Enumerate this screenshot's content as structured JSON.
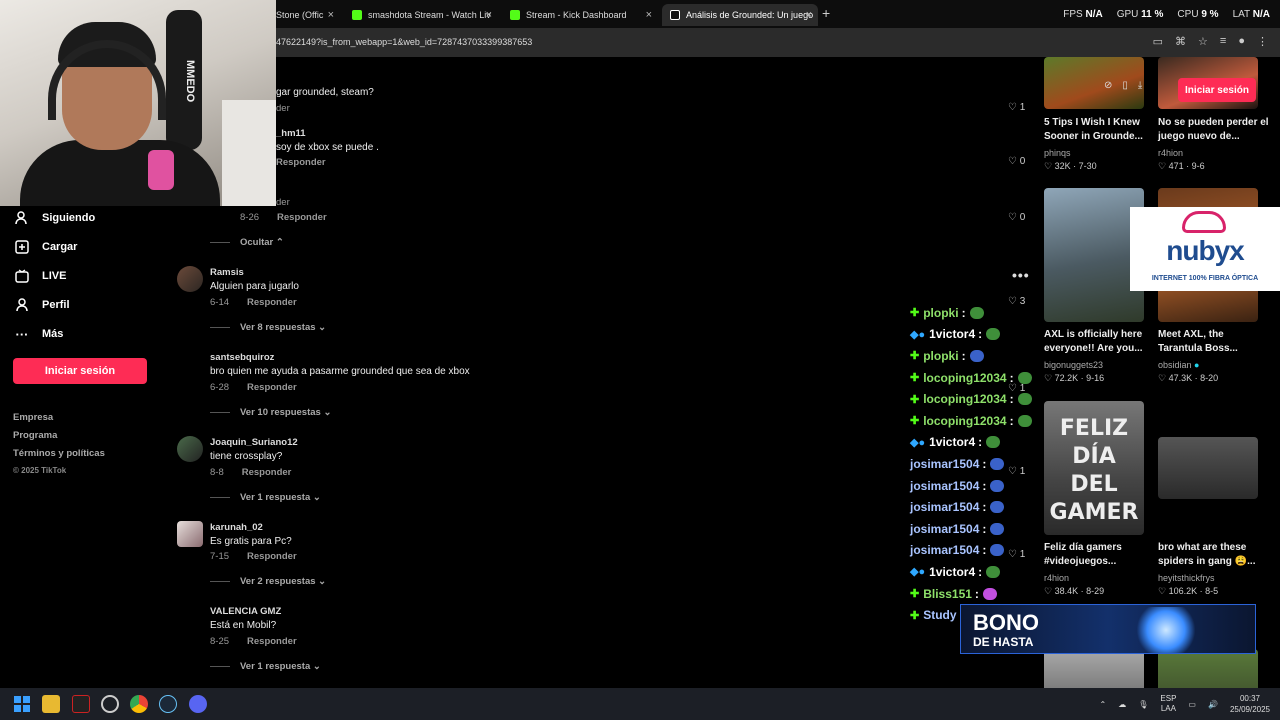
{
  "browser": {
    "tabs": [
      {
        "label": "Stone (Offic",
        "close": "×"
      },
      {
        "label": "smashdota Stream - Watch Liv",
        "close": "×"
      },
      {
        "label": "Stream - Kick Dashboard",
        "close": "×"
      },
      {
        "label": "Análisis de Grounded: Un juego",
        "close": "×"
      }
    ],
    "new_tab": "+",
    "url": "47622149?is_from_webapp=1&web_id=7287437033399387653",
    "stats": {
      "fps_label": "FPS",
      "fps_value": "N/A",
      "gpu_label": "GPU",
      "gpu_value": "11 %",
      "cpu_label": "CPU",
      "cpu_value": "9 %",
      "lat_label": "LAT",
      "lat_value": "N/A"
    }
  },
  "webcam": {
    "bag_text": "MMEDO"
  },
  "nav": {
    "items": [
      {
        "label": "Siguiendo",
        "icon": "following-icon"
      },
      {
        "label": "Cargar",
        "icon": "upload-icon"
      },
      {
        "label": "LIVE",
        "icon": "live-icon"
      },
      {
        "label": "Perfil",
        "icon": "profile-icon"
      },
      {
        "label": "Más",
        "icon": "more-icon"
      }
    ],
    "login": "Iniciar sesión",
    "links": [
      "Empresa",
      "Programa",
      "Términos y políticas"
    ],
    "copyright": "© 2025 TikTok"
  },
  "comments": {
    "partial": [
      {
        "text": "gar grounded, steam?",
        "meta": "der",
        "likes": "1"
      },
      {
        "user": "_hm11",
        "text": "soy de xbox se puede .",
        "reply": "Responder",
        "likes": "0"
      },
      {
        "text": "der",
        "date": "8-26",
        "reply": "Responder",
        "likes": "0"
      }
    ],
    "hide": "Ocultar",
    "list": [
      {
        "user": "Ramsis",
        "text": "Alguien para jugarlo",
        "date": "6-14",
        "reply": "Responder",
        "more": "Ver 8 respuestas",
        "likes": "3"
      },
      {
        "user": "santsebquiroz",
        "text": "bro quien me ayuda a pasarme grounded que sea de xbox",
        "date": "6-28",
        "reply": "Responder",
        "more": "Ver 10 respuestas",
        "likes": "1"
      },
      {
        "user": "Joaquin_Suriano12",
        "text": "tiene crossplay?",
        "date": "8-8",
        "reply": "Responder",
        "more": "Ver 1 respuesta",
        "likes": "1"
      },
      {
        "user": "karunah_02",
        "text": "Es gratis para Pc?",
        "date": "7-15",
        "reply": "Responder",
        "more": "Ver 2 respuestas",
        "likes": "1"
      },
      {
        "user": "VALENCIA GMZ",
        "text": "Está en Mobil?",
        "date": "8-25",
        "reply": "Responder",
        "more": "Ver 1 respuesta"
      }
    ],
    "options": "•••"
  },
  "chat": [
    {
      "user": "plopki",
      "color": "#8ee06a",
      "badge": "kick",
      "emote": "green"
    },
    {
      "user": "1victor4",
      "color": "#ffffff",
      "badge": "multi",
      "emote": "green"
    },
    {
      "user": "plopki",
      "color": "#8ee06a",
      "badge": "kick",
      "emote": "blue"
    },
    {
      "user": "locoping12034",
      "color": "#8ee06a",
      "badge": "kick",
      "emote": "green"
    },
    {
      "user": "locoping12034",
      "color": "#8ee06a",
      "badge": "kick",
      "emote": "green"
    },
    {
      "user": "locoping12034",
      "color": "#8ee06a",
      "badge": "kick",
      "emote": "green"
    },
    {
      "user": "1victor4",
      "color": "#ffffff",
      "badge": "multi",
      "emote": "green"
    },
    {
      "user": "josimar1504",
      "color": "#a9c4ff",
      "badge": "",
      "emote": "blue"
    },
    {
      "user": "josimar1504",
      "color": "#a9c4ff",
      "badge": "",
      "emote": "blue"
    },
    {
      "user": "josimar1504",
      "color": "#a9c4ff",
      "badge": "",
      "emote": "blue"
    },
    {
      "user": "josimar1504",
      "color": "#a9c4ff",
      "badge": "",
      "emote": "blue"
    },
    {
      "user": "josimar1504",
      "color": "#a9c4ff",
      "badge": "",
      "emote": "blue"
    },
    {
      "user": "1victor4",
      "color": "#ffffff",
      "badge": "multi",
      "emote": "green"
    },
    {
      "user": "Bliss151",
      "color": "#8ee06a",
      "badge": "kick",
      "emote": "pink"
    },
    {
      "user": "Study",
      "color": "#a9c4ff",
      "badge": "kick",
      "emote": ""
    }
  ],
  "chat_sep": ":",
  "videos": [
    {
      "title": "5 Tips I Wish I Knew Sooner in Grounde...",
      "author": "phinqs",
      "views": "32K",
      "date": "7-30"
    },
    {
      "title": "No se pueden perder el juego nuevo de...",
      "author": "r4hion",
      "views": "471",
      "date": "9-6"
    },
    {
      "title": "AXL is officially here everyone!! Are you...",
      "author": "bigonuggets23",
      "views": "72.2K",
      "date": "9-16"
    },
    {
      "title": "Meet AXL, the Tarantula Boss...",
      "author": "obsidian",
      "views": "47.3K",
      "date": "8-20"
    },
    {
      "title": "Feliz día gamers #videojuegos...",
      "author": "r4hion",
      "views": "38.4K",
      "date": "8-29"
    },
    {
      "title": "bro what are these spiders in gang 😩...",
      "author": "heyitsthickfrys",
      "views": "106.2K",
      "date": "8-5"
    }
  ],
  "thumb_text": {
    "feliz": "FELIZ",
    "dia": "DÍA",
    "del": "DEL",
    "gamer": "GAMER"
  },
  "grid_login": "Iniciar sesión",
  "ads": {
    "nubyx_name": "nubyx",
    "nubyx_tag": "INTERNET 100% FIBRA ÓPTICA",
    "bono_title": "BONO",
    "bono_sub": "DE HASTA"
  },
  "taskbar": {
    "lang1": "ESP",
    "lang2": "LAA",
    "time": "00:37",
    "date": "25/09/2025"
  },
  "colors": {
    "accent": "#fe2c55",
    "kick": "#53fc18"
  }
}
